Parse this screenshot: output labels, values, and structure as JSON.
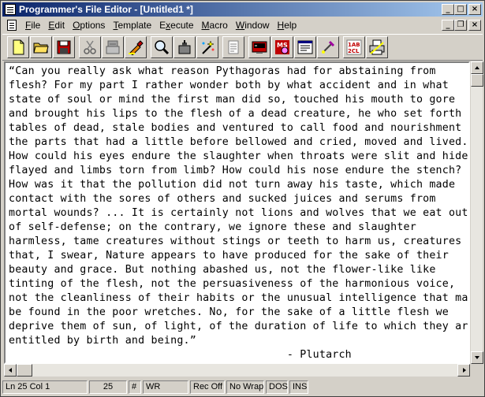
{
  "window": {
    "title": "Programmer's File Editor - [Untitled1 *]",
    "controls": {
      "minimize": "_",
      "maximize": "□",
      "close": "×"
    }
  },
  "menu": {
    "items": [
      {
        "label": "File",
        "accel": "F"
      },
      {
        "label": "Edit",
        "accel": "E"
      },
      {
        "label": "Options",
        "accel": "O"
      },
      {
        "label": "Template",
        "accel": "T"
      },
      {
        "label": "Execute",
        "accel": "x"
      },
      {
        "label": "Macro",
        "accel": "M"
      },
      {
        "label": "Window",
        "accel": "W"
      },
      {
        "label": "Help",
        "accel": "H"
      }
    ],
    "mdi_controls": {
      "minimize": "_",
      "restore": "❐",
      "close": "×"
    }
  },
  "toolbar": {
    "buttons": [
      "new-file-icon",
      "open-folder-icon",
      "save-icon",
      "cut-icon",
      "copy-icon",
      "paste-icon",
      "find-icon",
      "replace-icon",
      "insert-file-icon",
      "print-icon",
      "dos-command-icon",
      "ms-help-icon",
      "window-list-icon",
      "wizard-icon",
      "case-change-icon",
      "options-icon"
    ],
    "ms_label": "MS",
    "case_label": "1AB\n2CL"
  },
  "editor": {
    "lines": [
      "“Can you really ask what reason Pythagoras had for abstaining from",
      "flesh? For my part I rather wonder both by what accident and in what",
      "state of soul or mind the first man did so, touched his mouth to gore",
      "and brought his lips to the flesh of a dead creature, he who set forth",
      "tables of dead, stale bodies and ventured to call food and nourishment",
      "the parts that had a little before bellowed and cried, moved and lived.",
      "How could his eyes endure the slaughter when throats were slit and hides",
      "flayed and limbs torn from limb? How could his nose endure the stench?",
      "How was it that the pollution did not turn away his taste, which made",
      "contact with the sores of others and sucked juices and serums from",
      "mortal wounds? ... It is certainly not lions and wolves that we eat out",
      "of self-defense; on the contrary, we ignore these and slaughter",
      "harmless, tame creatures without stings or teeth to harm us, creatures",
      "that, I swear, Nature appears to have produced for the sake of their",
      "beauty and grace. But nothing abashed us, not the flower-like like",
      "tinting of the flesh, not the persuasiveness of the harmonious voice,",
      "not the cleanliness of their habits or the unusual intelligence that may",
      "be found in the poor wretches. No, for the sake of a little flesh we",
      "deprive them of sun, of light, of the duration of life to which they are",
      "entitled by birth and being.”",
      "                                           - Plutarch"
    ]
  },
  "status": {
    "position": "Ln 25 Col 1",
    "field2": "25",
    "field3": "#",
    "field4": "WR",
    "field5": "",
    "rec": "Rec Off",
    "wrap": "No Wrap",
    "mode": "DOS",
    "ins": "INS"
  },
  "colors": {
    "title_gradient_start": "#0a246a",
    "title_gradient_end": "#a6caf0",
    "chrome": "#d4d0c8",
    "editor_bg": "#ffffff"
  }
}
